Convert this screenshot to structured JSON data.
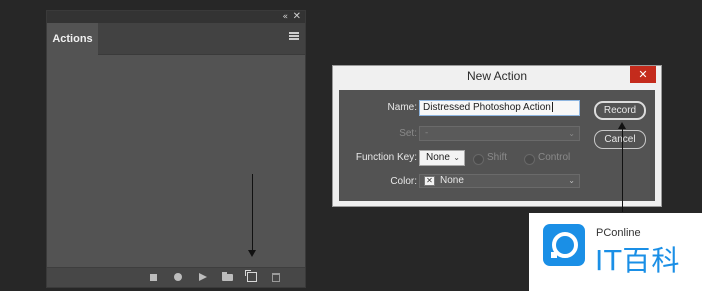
{
  "actions_panel": {
    "tab_label": "Actions",
    "header_icons": {
      "collapse": "«",
      "close": "✕"
    }
  },
  "dialog": {
    "title": "New Action",
    "close_glyph": "✕",
    "name_label": "Name:",
    "name_value": "Distressed Photoshop Action",
    "set_label": "Set:",
    "set_value": "-",
    "function_key_label": "Function Key:",
    "function_key_value": "None",
    "shift_label": "Shift",
    "control_label": "Control",
    "color_label": "Color:",
    "color_value": "None",
    "record_button": "Record",
    "cancel_button": "Cancel"
  },
  "watermark": {
    "text": "PConline",
    "brand": "IT百科"
  }
}
